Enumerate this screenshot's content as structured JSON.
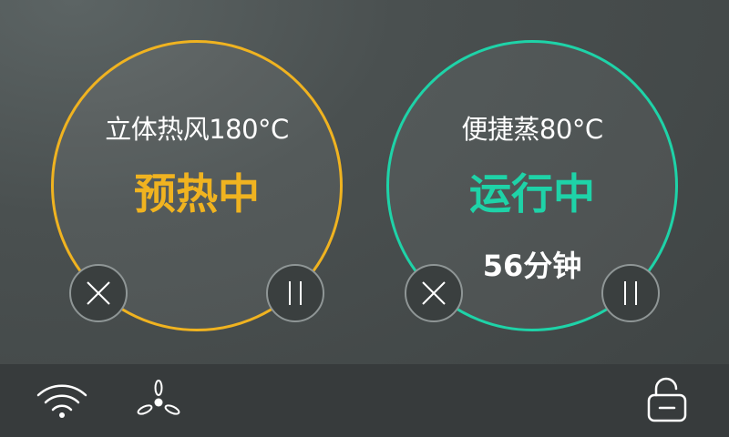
{
  "colors": {
    "preheat_accent": "#f0b320",
    "running_accent": "#1ed3a8",
    "text": "#ffffff"
  },
  "left_panel": {
    "title": "立体热风180°C",
    "status": "预热中",
    "buttons": {
      "cancel_icon": "close-icon",
      "pause_icon": "pause-icon"
    }
  },
  "right_panel": {
    "title": "便捷蒸80°C",
    "status": "运行中",
    "remaining_time": "56分钟",
    "buttons": {
      "cancel_icon": "close-icon",
      "pause_icon": "pause-icon"
    }
  },
  "bottom_bar": {
    "icons": [
      "wifi-icon",
      "fan-icon",
      "unlock-icon"
    ]
  }
}
